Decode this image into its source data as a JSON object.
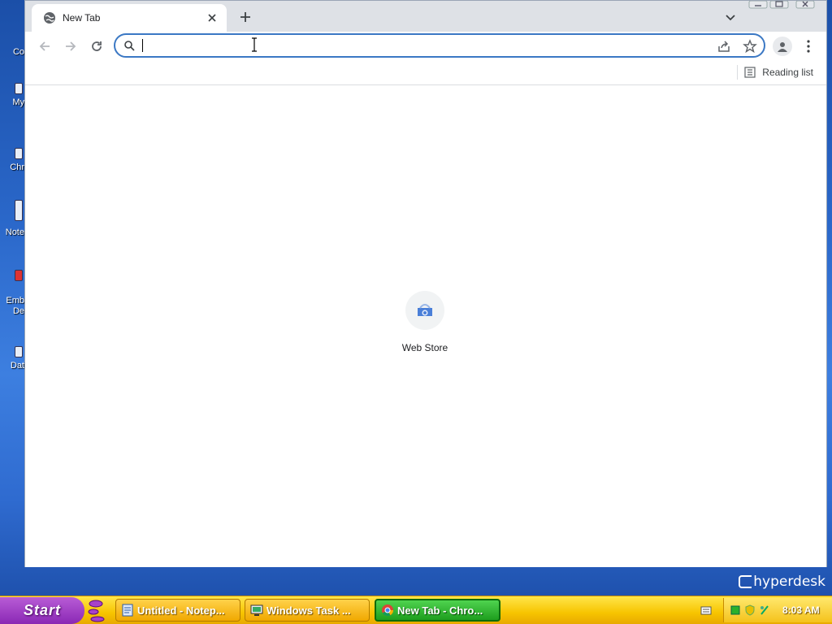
{
  "desktop": {
    "icons": [
      {
        "label": "Co",
        "top": 0
      },
      {
        "label": "My",
        "top": 0
      },
      {
        "label": "Chr",
        "top": 0
      },
      {
        "label": "Note",
        "top": 0
      },
      {
        "label": "Emb\nDe",
        "top": 0
      },
      {
        "label": "Dat",
        "top": 0
      }
    ],
    "logo": "hyperdesk"
  },
  "browser": {
    "tab": {
      "title": "New Tab"
    },
    "omnibox": {
      "value": "",
      "placeholder": ""
    },
    "bookmarks_bar": {
      "reading_list_label": "Reading list"
    },
    "shortcuts": [
      {
        "label": "Web Store"
      }
    ]
  },
  "taskbar": {
    "start_label": "Start",
    "tasks": [
      {
        "label": "Untitled - Notep..."
      },
      {
        "label": "Windows Task ..."
      },
      {
        "label": "New Tab - Chro..."
      }
    ],
    "clock": "8:03 AM"
  },
  "colors": {
    "accent": "#3b78c4",
    "taskbar": "#f7c400",
    "start": "#8a28b4",
    "active_task": "#1e9e1e"
  }
}
